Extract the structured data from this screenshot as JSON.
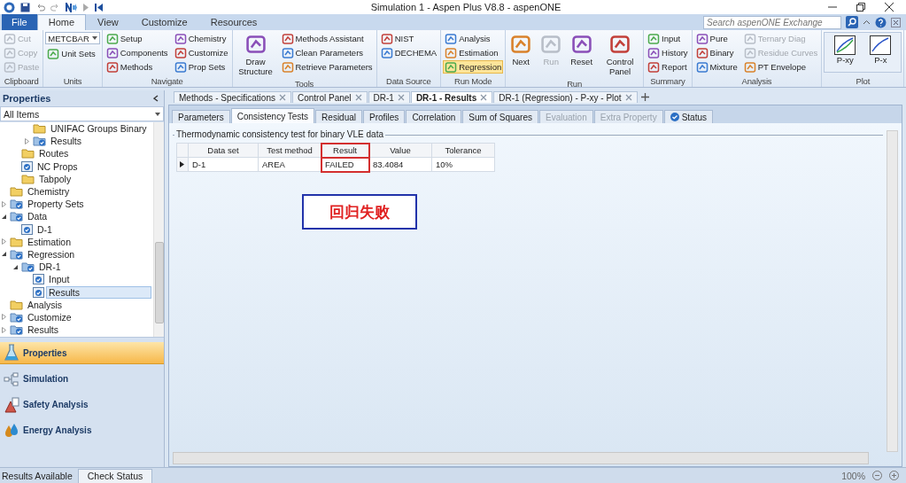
{
  "window": {
    "title": "Simulation 1 - Aspen Plus V8.8 - aspenONE"
  },
  "search": {
    "placeholder": "Search aspenONE Exchange"
  },
  "ribbon_tabs": [
    {
      "label": "File",
      "kind": "file",
      "selected": false
    },
    {
      "label": "Home",
      "kind": "tab",
      "selected": true
    },
    {
      "label": "View",
      "kind": "tab",
      "selected": false
    },
    {
      "label": "Customize",
      "kind": "tab",
      "selected": false
    },
    {
      "label": "Resources",
      "kind": "tab",
      "selected": false
    }
  ],
  "ribbon_groups": [
    {
      "label": "Clipboard",
      "columns": [
        {
          "kind": "small",
          "items": [
            {
              "label": "Cut",
              "disabled": true,
              "selected": false
            },
            {
              "label": "Copy",
              "disabled": true,
              "selected": false
            },
            {
              "label": "Paste",
              "disabled": true,
              "selected": false
            }
          ]
        }
      ]
    },
    {
      "label": "Units",
      "columns": [
        {
          "kind": "small",
          "items": [
            {
              "label": "METCBAR",
              "kind": "dropdown",
              "disabled": false,
              "selected": false
            },
            {
              "label": "Unit Sets",
              "kind": "button",
              "disabled": false,
              "selected": false
            }
          ]
        }
      ]
    },
    {
      "label": "Navigate",
      "columns": [
        {
          "kind": "small",
          "items": [
            {
              "label": "Setup",
              "disabled": false,
              "selected": false
            },
            {
              "label": "Components",
              "disabled": false,
              "selected": false
            },
            {
              "label": "Methods",
              "disabled": false,
              "selected": false
            }
          ]
        },
        {
          "kind": "small",
          "items": [
            {
              "label": "Chemistry",
              "disabled": false,
              "selected": false
            },
            {
              "label": "Customize",
              "disabled": false,
              "selected": false
            },
            {
              "label": "Prop Sets",
              "disabled": false,
              "selected": false
            }
          ]
        }
      ]
    },
    {
      "label": "Tools",
      "columns": [
        {
          "kind": "large",
          "items": [
            {
              "label": "Draw Structure",
              "disabled": false,
              "selected": false
            }
          ]
        },
        {
          "kind": "small",
          "items": [
            {
              "label": "Methods Assistant",
              "disabled": false,
              "selected": false
            },
            {
              "label": "Clean Parameters",
              "disabled": false,
              "selected": false
            },
            {
              "label": "Retrieve Parameters",
              "disabled": false,
              "selected": false
            }
          ]
        }
      ]
    },
    {
      "label": "Data Source",
      "columns": [
        {
          "kind": "small",
          "items": [
            {
              "label": "NIST",
              "disabled": false,
              "selected": false
            },
            {
              "label": "DECHEMA",
              "disabled": false,
              "selected": false
            }
          ]
        }
      ]
    },
    {
      "label": "Run Mode",
      "columns": [
        {
          "kind": "small",
          "items": [
            {
              "label": "Analysis",
              "disabled": false,
              "selected": false
            },
            {
              "label": "Estimation",
              "disabled": false,
              "selected": false
            },
            {
              "label": "Regression",
              "disabled": false,
              "selected": true
            }
          ]
        }
      ]
    },
    {
      "label": "Run",
      "columns": [
        {
          "kind": "large",
          "items": [
            {
              "label": "Next",
              "disabled": false,
              "selected": false
            },
            {
              "label": "Run",
              "disabled": true,
              "selected": false
            },
            {
              "label": "Reset",
              "disabled": false,
              "selected": false
            },
            {
              "label": "Control Panel",
              "disabled": false,
              "selected": false
            }
          ]
        }
      ]
    },
    {
      "label": "Summary",
      "columns": [
        {
          "kind": "small",
          "items": [
            {
              "label": "Input",
              "disabled": false,
              "selected": false
            },
            {
              "label": "History",
              "disabled": false,
              "selected": false
            },
            {
              "label": "Report",
              "disabled": false,
              "selected": false
            }
          ]
        }
      ]
    },
    {
      "label": "Analysis",
      "columns": [
        {
          "kind": "small",
          "items": [
            {
              "label": "Pure",
              "disabled": false,
              "selected": false
            },
            {
              "label": "Binary",
              "disabled": false,
              "selected": false
            },
            {
              "label": "Mixture",
              "disabled": false,
              "selected": false
            }
          ]
        },
        {
          "kind": "small",
          "items": [
            {
              "label": "Ternary Diag",
              "disabled": true,
              "selected": false
            },
            {
              "label": "Residue Curves",
              "disabled": true,
              "selected": false
            },
            {
              "label": "PT Envelope",
              "disabled": false,
              "selected": false
            }
          ]
        }
      ]
    },
    {
      "label": "Plot",
      "columns": [
        {
          "kind": "gallery",
          "items": [
            {
              "label": "P-xy",
              "disabled": false,
              "selected": false
            },
            {
              "label": "P-x",
              "disabled": false,
              "selected": false
            }
          ]
        }
      ]
    }
  ],
  "sidebar": {
    "title": "Properties",
    "filter": "All Items",
    "tree": [
      {
        "children": [
          {
            "children": [
              {
                "label": "UNIFAC Groups Binary",
                "kind": "folder",
                "selected": false
              },
              {
                "label": "Results",
                "kind": "folder-check",
                "expanded": false,
                "selected": false
              }
            ]
          },
          {
            "label": "Routes",
            "kind": "folder",
            "selected": false
          },
          {
            "label": "NC Props",
            "kind": "form",
            "selected": false
          },
          {
            "label": "Tabpoly",
            "kind": "folder",
            "selected": false
          }
        ]
      },
      {
        "label": "Chemistry",
        "kind": "folder",
        "selected": false
      },
      {
        "label": "Property Sets",
        "kind": "folder-check",
        "expanded": false,
        "selected": false
      },
      {
        "label": "Data",
        "kind": "folder-check",
        "expanded": true,
        "selected": false,
        "children": [
          {
            "label": "D-1",
            "kind": "form",
            "selected": false
          }
        ]
      },
      {
        "label": "Estimation",
        "kind": "folder",
        "expanded": false,
        "selected": false
      },
      {
        "label": "Regression",
        "kind": "folder-check",
        "expanded": true,
        "selected": false,
        "children": [
          {
            "label": "DR-1",
            "kind": "folder-check",
            "expanded": true,
            "selected": false,
            "children": [
              {
                "label": "Input",
                "kind": "form",
                "selected": false
              },
              {
                "label": "Results",
                "kind": "form",
                "selected": true
              }
            ]
          }
        ]
      },
      {
        "label": "Analysis",
        "kind": "folder",
        "selected": false
      },
      {
        "label": "Customize",
        "kind": "folder-check",
        "expanded": false,
        "selected": false
      },
      {
        "label": "Results",
        "kind": "folder-check",
        "expanded": false,
        "selected": false
      }
    ],
    "nav": [
      {
        "label": "Properties",
        "kind": "flask",
        "selected": true
      },
      {
        "label": "Simulation",
        "kind": "flowsheet",
        "selected": false
      },
      {
        "label": "Safety Analysis",
        "kind": "safety",
        "selected": false
      },
      {
        "label": "Energy Analysis",
        "kind": "energy",
        "selected": false
      }
    ]
  },
  "doc_tabs": [
    {
      "label": "Methods - Specifications",
      "selected": false
    },
    {
      "label": "Control Panel",
      "selected": false
    },
    {
      "label": "DR-1",
      "selected": false
    },
    {
      "label": "DR-1 - Results",
      "selected": true
    },
    {
      "label": "DR-1 (Regression) - P-xy - Plot",
      "selected": false
    }
  ],
  "sheet_tabs": [
    {
      "label": "Parameters",
      "selected": false,
      "disabled": false
    },
    {
      "label": "Consistency Tests",
      "selected": true,
      "disabled": false
    },
    {
      "label": "Residual",
      "selected": false,
      "disabled": false
    },
    {
      "label": "Profiles",
      "selected": false,
      "disabled": false
    },
    {
      "label": "Correlation",
      "selected": false,
      "disabled": false
    },
    {
      "label": "Sum of Squares",
      "selected": false,
      "disabled": false
    },
    {
      "label": "Evaluation",
      "selected": false,
      "disabled": true
    },
    {
      "label": "Extra Property",
      "selected": false,
      "disabled": true
    },
    {
      "label": "Status",
      "selected": false,
      "disabled": false,
      "kind": "status"
    }
  ],
  "consistency": {
    "title": "Thermodynamic consistency test for binary VLE data",
    "columns": [
      {
        "label": "Data set",
        "highlighted": false
      },
      {
        "label": "Test method",
        "highlighted": false
      },
      {
        "label": "Result",
        "highlighted": true
      },
      {
        "label": "Value",
        "highlighted": false
      },
      {
        "label": "Tolerance",
        "highlighted": false
      }
    ],
    "rows": [
      [
        "D-1",
        "AREA",
        "FAILED",
        "83.4084",
        "10%"
      ]
    ]
  },
  "annotation": {
    "text": "回归失败"
  },
  "status_bar": {
    "message": "Results Available",
    "button": "Check Status",
    "zoom": "100%"
  }
}
